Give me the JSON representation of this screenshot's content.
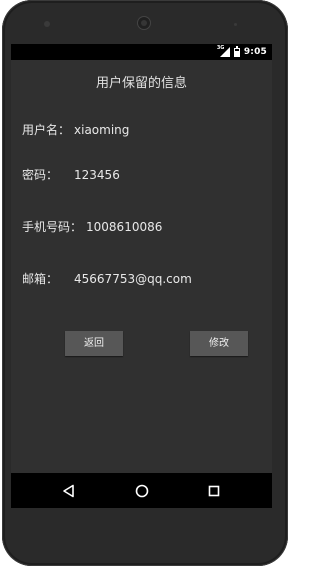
{
  "statusbar": {
    "network": "3G",
    "time": "9:05"
  },
  "screen": {
    "title": "用户保留的信息",
    "fields": [
      {
        "label": "用户名：",
        "value": "xiaoming"
      },
      {
        "label": "密码：",
        "value": "123456"
      },
      {
        "label": "手机号码：",
        "value": "1008610086"
      },
      {
        "label": "邮箱：",
        "value": "45667753@qq.com"
      }
    ],
    "buttons": {
      "back": "返回",
      "edit": "修改"
    }
  },
  "navbar": {
    "icons": [
      "back-triangle-icon",
      "home-circle-icon",
      "recents-square-icon"
    ]
  },
  "colors": {
    "app_background": "#303030",
    "button_background": "#575757",
    "phone_body": "#2a2a2a"
  }
}
